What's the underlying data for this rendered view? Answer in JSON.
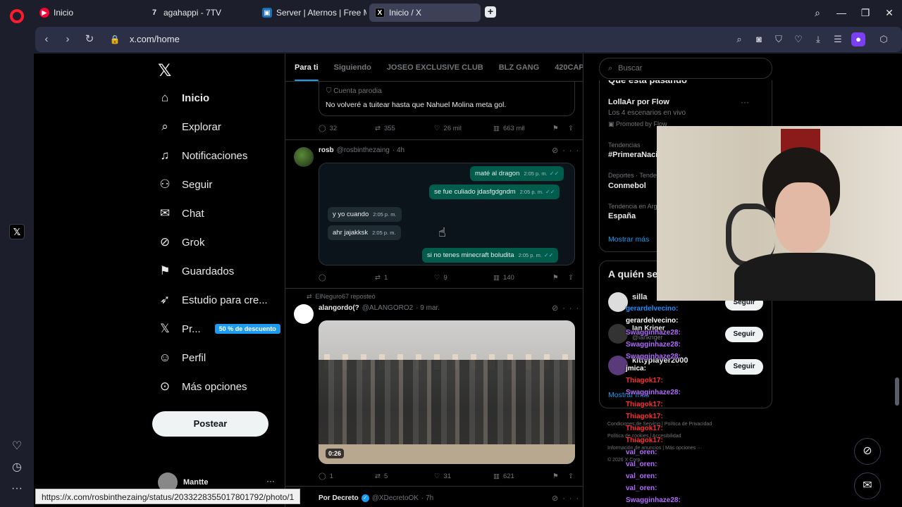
{
  "browser": {
    "tabs": [
      {
        "label": "Inicio",
        "icon": "youtube-icon"
      },
      {
        "label": "agahappi - 7TV",
        "icon": "7tv-icon"
      },
      {
        "label": "Server | Aternos | Free Mi",
        "icon": "aternos-icon"
      },
      {
        "label": "Inicio / X",
        "icon": "x-icon"
      }
    ],
    "url": "x.com/home",
    "status_url": "https://x.com/rosbinthezaing/status/2033228355017801792/photo/1"
  },
  "x": {
    "nav": [
      {
        "label": "Inicio",
        "icon": "home-icon"
      },
      {
        "label": "Explorar",
        "icon": "search-icon"
      },
      {
        "label": "Notificaciones",
        "icon": "bell-icon"
      },
      {
        "label": "Seguir",
        "icon": "add-user-icon"
      },
      {
        "label": "Chat",
        "icon": "mail-icon"
      },
      {
        "label": "Grok",
        "icon": "grok-icon"
      },
      {
        "label": "Guardados",
        "icon": "bookmark-icon"
      },
      {
        "label": "Estudio para cre...",
        "icon": "rocket-icon"
      },
      {
        "label": "Pr...",
        "icon": "x-icon"
      },
      {
        "label": "Perfil",
        "icon": "person-icon"
      },
      {
        "label": "Más opciones",
        "icon": "more-circle-icon"
      }
    ],
    "premium_badge": "50 % de descuento",
    "post_button": "Postear",
    "account_name": "Mantte"
  },
  "timeline": {
    "tabs": [
      "Para ti",
      "Siguiendo",
      "JOSEO EXCLUSIVE CLUB",
      "BLZ GANG",
      "420CAP"
    ],
    "tweet1": {
      "parody_label": "Cuenta parodia",
      "text": "No volveré a tuitear hasta que Nahuel Molina meta gol.",
      "replies": "32",
      "reposts": "355",
      "likes": "26 mil",
      "views": "663 mil"
    },
    "tweet2": {
      "name": "rosb",
      "handle": "@rosbinthezaing",
      "time": "· 4h",
      "messages": [
        {
          "text": "maté al dragon",
          "time": "2:05 p. m.",
          "dir": "out"
        },
        {
          "text": "se fue culiado jdasfgdgndm",
          "time": "2:05 p. m.",
          "dir": "out"
        },
        {
          "text": "y yo cuando",
          "time": "2:05 p. m.",
          "dir": "in"
        },
        {
          "text": "ahr jajakksk",
          "time": "2:05 p. m.",
          "dir": "in"
        },
        {
          "text": "si no tenes minecraft boludita",
          "time": "2:05 p. m.",
          "dir": "out"
        }
      ],
      "replies": "",
      "reposts": "1",
      "likes": "9",
      "views": "140"
    },
    "tweet3": {
      "repost_label": "ElNeguro67 reposteó",
      "name": "alangordo(?",
      "handle": "@ALANGORO2",
      "time": "· 9 mar.",
      "video_time": "0:26",
      "replies": "1",
      "reposts": "5",
      "likes": "31",
      "views": "621"
    },
    "tweet4": {
      "name": "Por Decreto",
      "handle": "@XDecretoOK",
      "time": "· 7h"
    }
  },
  "right": {
    "search_placeholder": "Buscar",
    "trends_title": "Qué está pasando",
    "promo": {
      "title": "LollaAr por Flow",
      "sub": "Los 4 escenarios en vivo",
      "promoted": "Promoted by Flow"
    },
    "trends": [
      {
        "context": "Tendencias",
        "name": "#PrimeraNaci"
      },
      {
        "context": "Deportes · Tende",
        "name": "Conmebol"
      },
      {
        "context": "Tendencia en Arg",
        "name": "España"
      }
    ],
    "show_more": "Mostrar más",
    "who_title": "A quién se",
    "who": [
      {
        "name": "silla"
      },
      {
        "name": "Ian Kriger",
        "handle": "@iankriger"
      },
      {
        "name": "kittyplayer2000",
        "handle": "@..."
      }
    ],
    "follow_label": "Seguir",
    "show_more2": "Mostrar más",
    "footer": [
      "Condiciones de Servicio",
      "Política de Privacidad",
      "Política de cookies",
      "Accesibilidad",
      "Información de anuncios",
      "Más opciones ···",
      "© 2026 X Corp."
    ]
  },
  "chat": [
    {
      "user": "gerardelvecino:",
      "color": "#1e90ff"
    },
    {
      "user": "gerardelvecino:",
      "color": "#ffffff"
    },
    {
      "user": "Swagginhaze28:",
      "color": "#b36bff"
    },
    {
      "user": "Swagginhaze28:",
      "color": "#b36bff"
    },
    {
      "user": "Swagginhaze28:",
      "color": "#b36bff"
    },
    {
      "user": "jmica:",
      "color": "#ffffff"
    },
    {
      "user": "Thiagok17:",
      "color": "#ff2d2d"
    },
    {
      "user": "Swagginhaze28:",
      "color": "#b36bff"
    },
    {
      "user": "Thiagok17:",
      "color": "#ff2d2d"
    },
    {
      "user": "Thiagok17:",
      "color": "#ff2d2d"
    },
    {
      "user": "Thiagok17:",
      "color": "#ff2d2d"
    },
    {
      "user": "Thiagok17:",
      "color": "#ff2d2d"
    },
    {
      "user": "val_oren:",
      "color": "#b36bff"
    },
    {
      "user": "val_oren:",
      "color": "#b36bff"
    },
    {
      "user": "val_oren:",
      "color": "#b36bff"
    },
    {
      "user": "val_oren:",
      "color": "#b36bff"
    },
    {
      "user": "Swagginhaze28:",
      "color": "#b36bff"
    }
  ],
  "colors": {
    "accent": "#1d9bf0",
    "opera": "#ff1b2d"
  }
}
